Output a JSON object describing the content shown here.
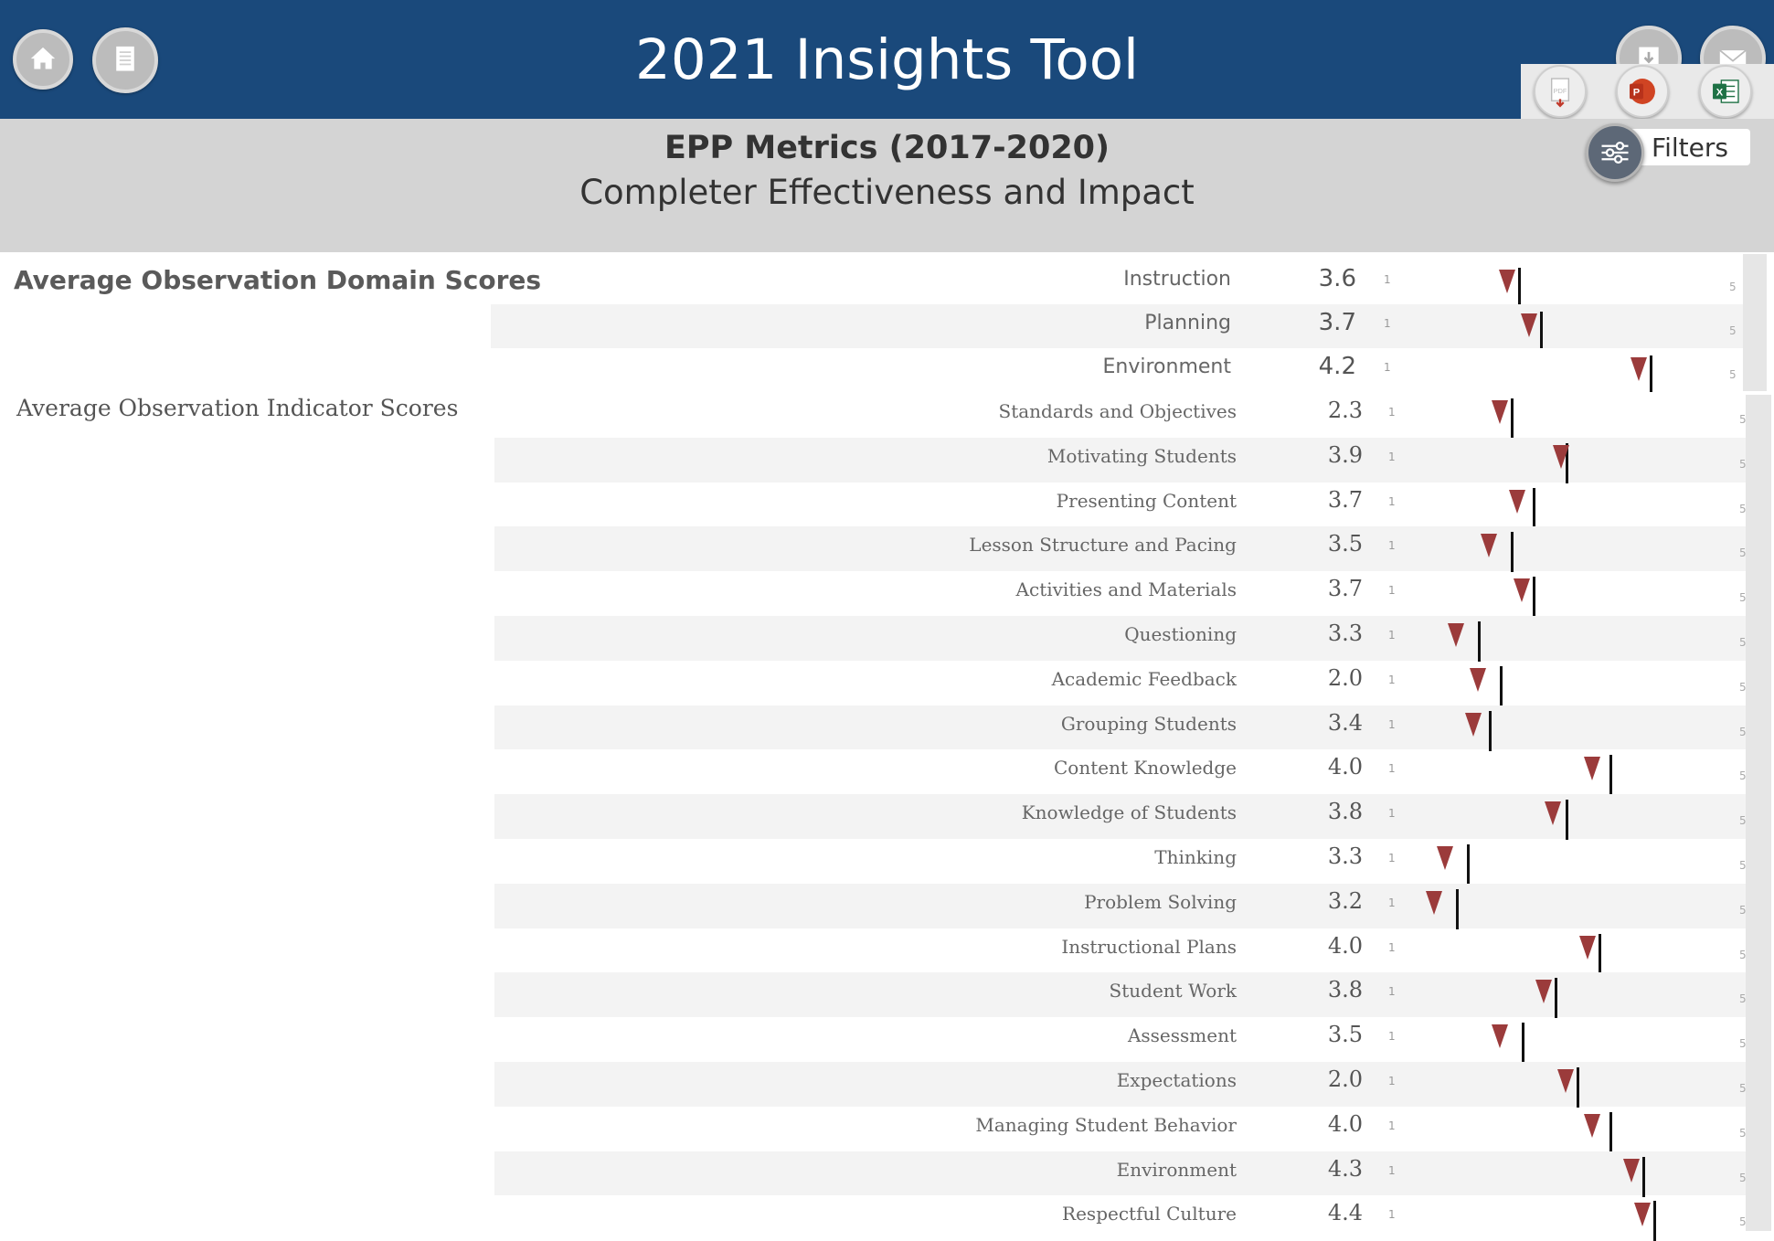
{
  "header": {
    "title": "2021 Insights Tool",
    "color": "#1a497b"
  },
  "toolbar": {
    "left_icons": [
      "home-icon",
      "document-icon"
    ],
    "right_icons": [
      "download-icon",
      "mail-icon"
    ],
    "export_icons": [
      "pdf-export-icon",
      "powerpoint-export-icon",
      "excel-export-icon"
    ],
    "export_labels": {
      "pdf": "PDF",
      "ppt": "P",
      "xls": "X"
    },
    "filters_label": "Filters"
  },
  "subheader": {
    "title": "EPP Metrics (2017-2020)",
    "subtitle": "Completer Effectiveness and Impact"
  },
  "domain_section": {
    "label": "Average Observation Domain Scores",
    "scale_min": "1",
    "scale_max": "5",
    "rows": [
      {
        "label": "Instruction",
        "value": "3.6",
        "ref": 3.6,
        "marker": 3.55
      },
      {
        "label": "Planning",
        "value": "3.7",
        "ref": 3.7,
        "marker": 3.65
      },
      {
        "label": "Environment",
        "value": "4.2",
        "ref": 4.2,
        "marker": 4.15
      }
    ]
  },
  "indicator_section": {
    "label": "Average Observation Indicator Scores",
    "scale_min": "1",
    "scale_max": "5",
    "rows": [
      {
        "label": "Standards and Objectives",
        "value": "2.3",
        "ref": 3.55,
        "marker": 3.5
      },
      {
        "label": "Motivating Students",
        "value": "3.9",
        "ref": 3.8,
        "marker": 3.78
      },
      {
        "label": "Presenting Content",
        "value": "3.7",
        "ref": 3.65,
        "marker": 3.58
      },
      {
        "label": "Lesson Structure and Pacing",
        "value": "3.5",
        "ref": 3.55,
        "marker": 3.45
      },
      {
        "label": "Activities and Materials",
        "value": "3.7",
        "ref": 3.65,
        "marker": 3.6
      },
      {
        "label": "Questioning",
        "value": "3.3",
        "ref": 3.4,
        "marker": 3.3
      },
      {
        "label": "Academic Feedback",
        "value": "2.0",
        "ref": 3.5,
        "marker": 3.4
      },
      {
        "label": "Grouping Students",
        "value": "3.4",
        "ref": 3.45,
        "marker": 3.38
      },
      {
        "label": "Content Knowledge",
        "value": "4.0",
        "ref": 4.0,
        "marker": 3.92
      },
      {
        "label": "Knowledge of Students",
        "value": "3.8",
        "ref": 3.8,
        "marker": 3.74
      },
      {
        "label": "Thinking",
        "value": "3.3",
        "ref": 3.35,
        "marker": 3.25
      },
      {
        "label": "Problem Solving",
        "value": "3.2",
        "ref": 3.3,
        "marker": 3.2
      },
      {
        "label": "Instructional Plans",
        "value": "4.0",
        "ref": 3.95,
        "marker": 3.9
      },
      {
        "label": "Student Work",
        "value": "3.8",
        "ref": 3.75,
        "marker": 3.7
      },
      {
        "label": "Assessment",
        "value": "3.5",
        "ref": 3.6,
        "marker": 3.5
      },
      {
        "label": "Expectations",
        "value": "2.0",
        "ref": 3.85,
        "marker": 3.8
      },
      {
        "label": "Managing Student Behavior",
        "value": "4.0",
        "ref": 4.0,
        "marker": 3.92
      },
      {
        "label": "Environment",
        "value": "4.3",
        "ref": 4.15,
        "marker": 4.1
      },
      {
        "label": "Respectful Culture",
        "value": "4.4",
        "ref": 4.2,
        "marker": 4.15
      }
    ]
  },
  "colors": {
    "marker": "#9b3b3b",
    "ref_line": "#111111",
    "row_alt": "#f3f3f3",
    "subheader_bg": "#d4d4d4"
  }
}
